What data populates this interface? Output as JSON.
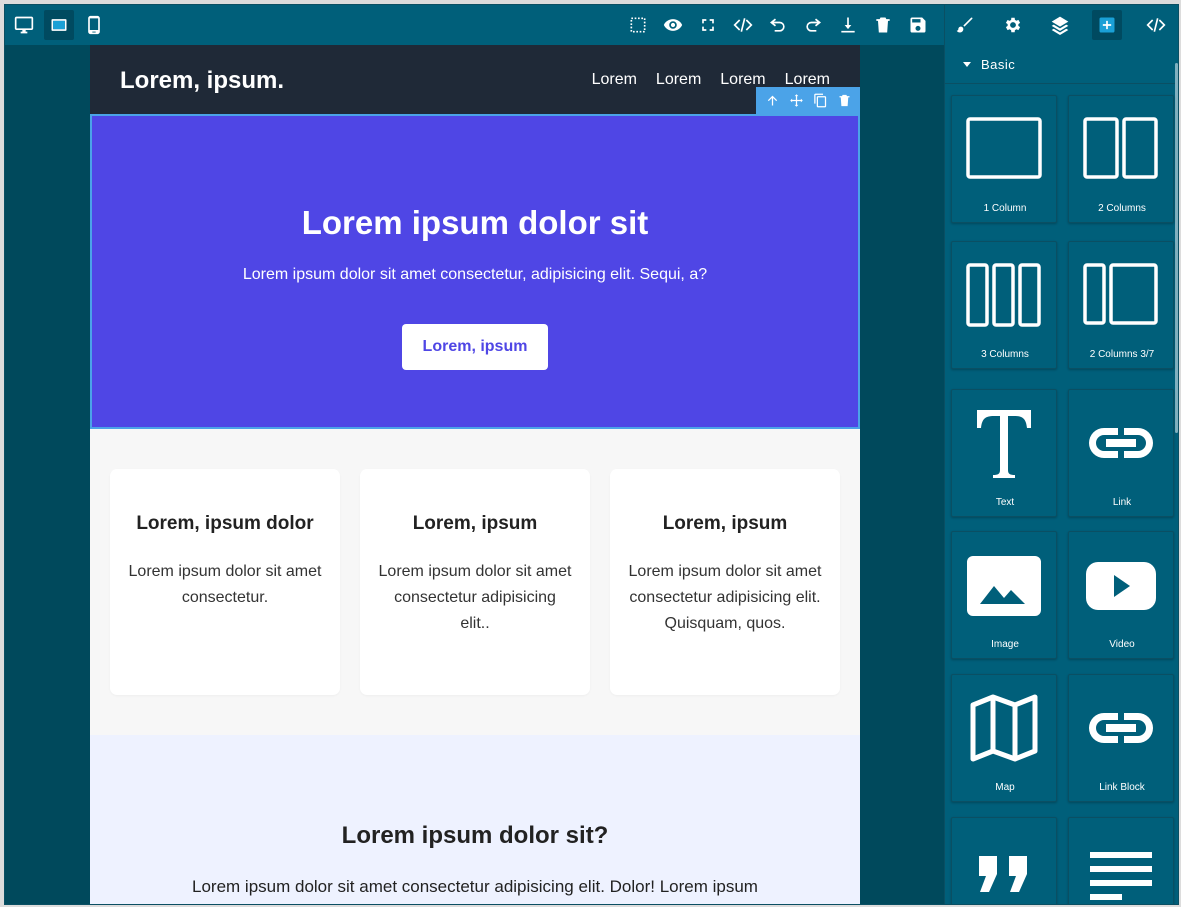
{
  "toolbar": {
    "devices": [
      {
        "name": "desktop",
        "icon": "desktop-icon"
      },
      {
        "name": "tablet",
        "icon": "tablet-icon",
        "active": true
      },
      {
        "name": "mobile",
        "icon": "mobile-icon"
      }
    ],
    "actions": [
      "sw-visibility-icon",
      "preview-icon",
      "fullscreen-icon",
      "code-view-icon",
      "undo-icon",
      "redo-icon",
      "export-icon",
      "clear-canvas-icon",
      "save-icon"
    ],
    "panels": [
      "style-manager-icon",
      "settings-icon",
      "layer-manager-icon",
      "blocks-icon",
      "code-icon"
    ]
  },
  "site": {
    "logo": "Lorem, ipsum.",
    "nav_links": [
      "Lorem",
      "Lorem",
      "Lorem",
      "Lorem"
    ],
    "hero": {
      "title": "Lorem ipsum dolor sit",
      "subtitle": "Lorem ipsum dolor sit amet consectetur, adipisicing elit. Sequi, a?",
      "button": "Lorem, ipsum"
    },
    "cards": [
      {
        "title": "Lorem, ipsum dolor",
        "text": "Lorem ipsum dolor sit amet consectetur."
      },
      {
        "title": "Lorem, ipsum",
        "text": "Lorem ipsum dolor sit amet consectetur adipisicing elit.."
      },
      {
        "title": "Lorem, ipsum",
        "text": "Lorem ipsum dolor sit amet consectetur adipisicing elit. Quisquam, quos."
      }
    ],
    "faq": {
      "title": "Lorem ipsum dolor sit?",
      "text": "Lorem ipsum dolor sit amet consectetur adipisicing elit. Dolor! Lorem ipsum"
    }
  },
  "blocks_panel": {
    "category": "Basic",
    "blocks": [
      {
        "label": "1 Column",
        "icon": "one-column-icon"
      },
      {
        "label": "2 Columns",
        "icon": "two-columns-icon"
      },
      {
        "label": "3 Columns",
        "icon": "three-columns-icon"
      },
      {
        "label": "2 Columns 3/7",
        "icon": "two-columns-3-7-icon"
      },
      {
        "label": "Text",
        "icon": "text-icon"
      },
      {
        "label": "Link",
        "icon": "link-icon"
      },
      {
        "label": "Image",
        "icon": "image-icon"
      },
      {
        "label": "Video",
        "icon": "video-icon"
      },
      {
        "label": "Map",
        "icon": "map-icon"
      },
      {
        "label": "Link Block",
        "icon": "link-block-icon"
      },
      {
        "label": "",
        "icon": "quote-icon"
      },
      {
        "label": "",
        "icon": "text-section-icon"
      }
    ]
  },
  "colors": {
    "editor_bg": "#005f7a",
    "canvas_bg": "#00495c",
    "hero_bg": "#4f46e5",
    "nav_bg": "#1f2937",
    "selection": "#4ba3e8"
  }
}
